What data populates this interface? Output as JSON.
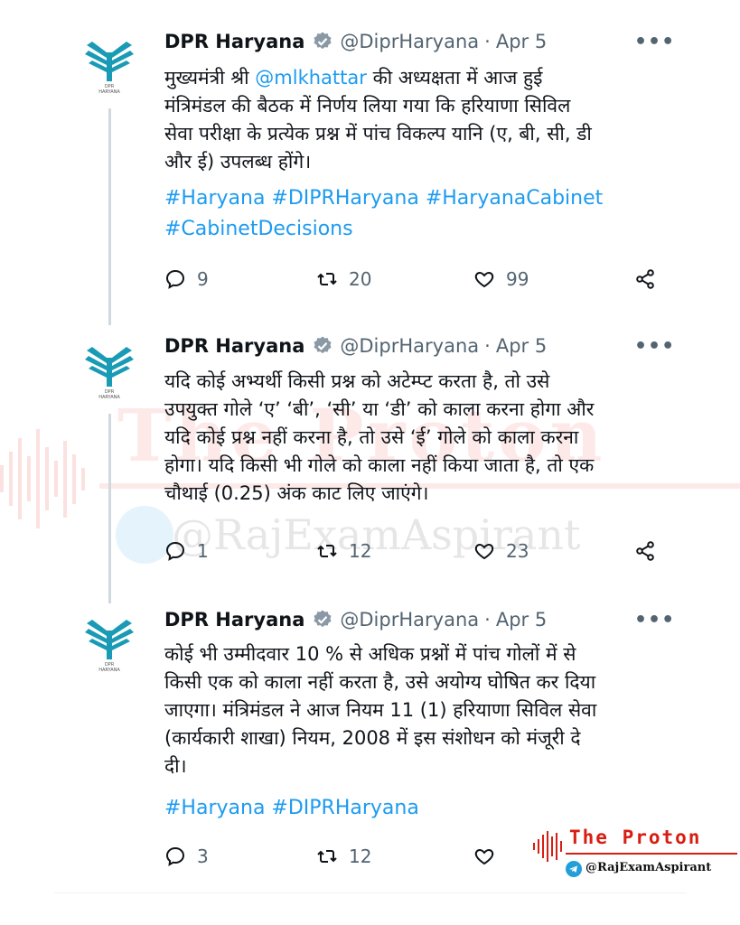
{
  "watermark": {
    "title": "The Proton",
    "handle": "@RajExamAspirant"
  },
  "tweets": [
    {
      "name": "DPR Haryana",
      "handle": "@DiprHaryana",
      "date": "Apr 5",
      "more": "•••",
      "lines": [
        [
          "मुख्यमंत्री श्री ",
          "@mlkhattar",
          " की अध्यक्षता में आज हुई"
        ],
        "मंत्रिमंडल की बैठक में निर्णय लिया गया कि हरियाणा सिविल",
        "सेवा परीक्षा के प्रत्येक प्रश्न में पांच विकल्प यानि (ए, बी, सी, डी",
        "और ई) उपलब्ध होंगे।"
      ],
      "tags": [
        "#Haryana #DIPRHaryana #HaryanaCabinet",
        "#CabinetDecisions"
      ],
      "replies": "9",
      "retweets": "20",
      "likes": "99"
    },
    {
      "name": "DPR Haryana",
      "handle": "@DiprHaryana",
      "date": "Apr 5",
      "more": "•••",
      "lines": [
        "यदि कोई अभ्यर्थी किसी प्रश्न को अटेम्प्ट करता है, तो उसे",
        "उपयुक्त गोले ‘ए’ ‘बी’, ‘सी’ या ‘डी’  को काला करना होगा और",
        "यदि कोई प्रश्न नहीं करना है, तो उसे ‘ई’ गोले को काला करना",
        "होगा। यदि किसी भी गोले को काला नहीं किया जाता है, तो एक",
        "चौथाई (0.25) अंक काट लिए जाएंगे।"
      ],
      "tags": [],
      "replies": "1",
      "retweets": "12",
      "likes": "23"
    },
    {
      "name": "DPR Haryana",
      "handle": "@DiprHaryana",
      "date": "Apr 5",
      "more": "•••",
      "lines": [
        "कोई भी उम्मीदवार 10 % से अधिक प्रश्नों में पांच गोलों में से",
        "किसी एक को काला नहीं करता है, उसे अयोग्य घोषित कर दिया",
        "जाएगा। मंत्रिमंडल ने आज नियम 11 (1) हरियाणा सिविल सेवा",
        "(कार्यकारी शाखा) नियम, 2008 में इस संशोधन को मंजूरी दे",
        "दी।"
      ],
      "tags": [
        "#Haryana #DIPRHaryana"
      ],
      "replies": "3",
      "retweets": "12",
      "likes": ""
    }
  ],
  "badge": {
    "title": "The Proton",
    "handle": "@RajExamAspirant"
  },
  "colors": {
    "link": "#1d9bf0",
    "muted": "#536471",
    "logo": "#1a9bb5",
    "brand_red": "#d81e12",
    "verified_badge": "#8b98a5"
  },
  "icons": {
    "reply": "speech-bubble-icon",
    "retweet": "retweet-arrows-icon",
    "like": "heart-icon",
    "share": "share-nodes-icon",
    "verified": "verified-badge-icon",
    "telegram": "telegram-icon"
  }
}
